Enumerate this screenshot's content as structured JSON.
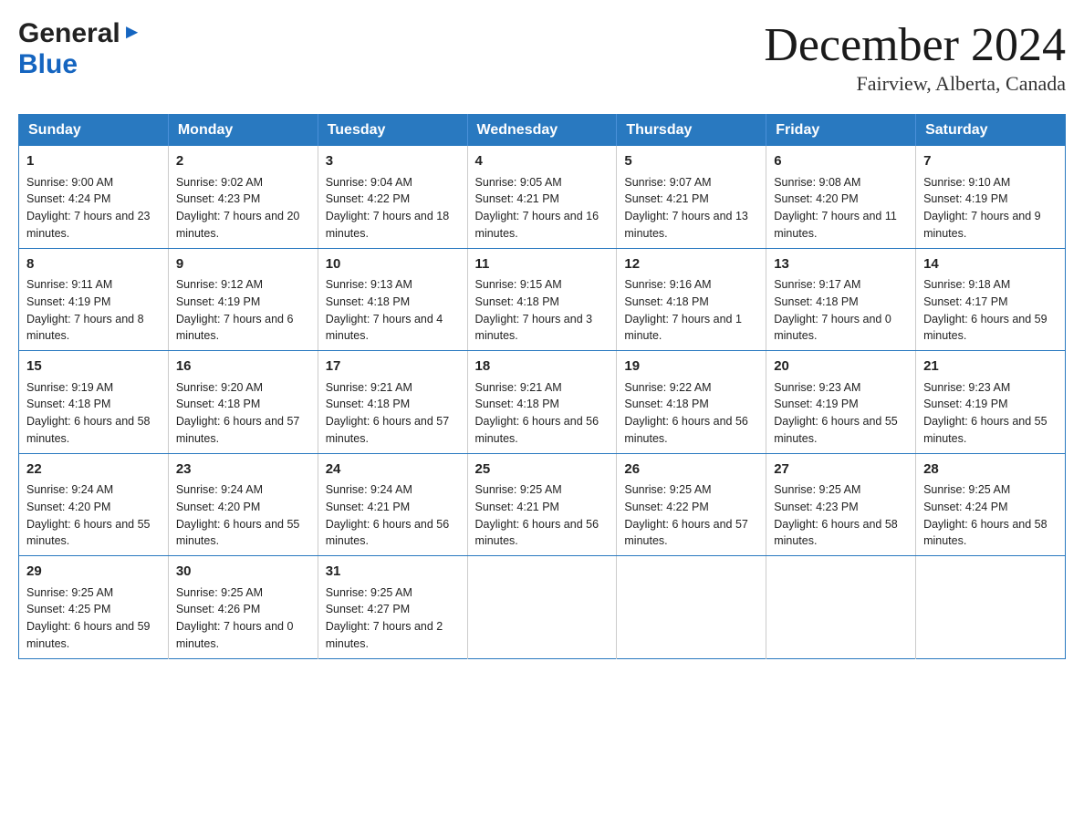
{
  "header": {
    "logo_general": "General",
    "logo_blue": "Blue",
    "month_title": "December 2024",
    "location": "Fairview, Alberta, Canada"
  },
  "calendar": {
    "days_of_week": [
      "Sunday",
      "Monday",
      "Tuesday",
      "Wednesday",
      "Thursday",
      "Friday",
      "Saturday"
    ],
    "weeks": [
      [
        {
          "day": "1",
          "sunrise": "9:00 AM",
          "sunset": "4:24 PM",
          "daylight": "7 hours and 23 minutes."
        },
        {
          "day": "2",
          "sunrise": "9:02 AM",
          "sunset": "4:23 PM",
          "daylight": "7 hours and 20 minutes."
        },
        {
          "day": "3",
          "sunrise": "9:04 AM",
          "sunset": "4:22 PM",
          "daylight": "7 hours and 18 minutes."
        },
        {
          "day": "4",
          "sunrise": "9:05 AM",
          "sunset": "4:21 PM",
          "daylight": "7 hours and 16 minutes."
        },
        {
          "day": "5",
          "sunrise": "9:07 AM",
          "sunset": "4:21 PM",
          "daylight": "7 hours and 13 minutes."
        },
        {
          "day": "6",
          "sunrise": "9:08 AM",
          "sunset": "4:20 PM",
          "daylight": "7 hours and 11 minutes."
        },
        {
          "day": "7",
          "sunrise": "9:10 AM",
          "sunset": "4:19 PM",
          "daylight": "7 hours and 9 minutes."
        }
      ],
      [
        {
          "day": "8",
          "sunrise": "9:11 AM",
          "sunset": "4:19 PM",
          "daylight": "7 hours and 8 minutes."
        },
        {
          "day": "9",
          "sunrise": "9:12 AM",
          "sunset": "4:19 PM",
          "daylight": "7 hours and 6 minutes."
        },
        {
          "day": "10",
          "sunrise": "9:13 AM",
          "sunset": "4:18 PM",
          "daylight": "7 hours and 4 minutes."
        },
        {
          "day": "11",
          "sunrise": "9:15 AM",
          "sunset": "4:18 PM",
          "daylight": "7 hours and 3 minutes."
        },
        {
          "day": "12",
          "sunrise": "9:16 AM",
          "sunset": "4:18 PM",
          "daylight": "7 hours and 1 minute."
        },
        {
          "day": "13",
          "sunrise": "9:17 AM",
          "sunset": "4:18 PM",
          "daylight": "7 hours and 0 minutes."
        },
        {
          "day": "14",
          "sunrise": "9:18 AM",
          "sunset": "4:17 PM",
          "daylight": "6 hours and 59 minutes."
        }
      ],
      [
        {
          "day": "15",
          "sunrise": "9:19 AM",
          "sunset": "4:18 PM",
          "daylight": "6 hours and 58 minutes."
        },
        {
          "day": "16",
          "sunrise": "9:20 AM",
          "sunset": "4:18 PM",
          "daylight": "6 hours and 57 minutes."
        },
        {
          "day": "17",
          "sunrise": "9:21 AM",
          "sunset": "4:18 PM",
          "daylight": "6 hours and 57 minutes."
        },
        {
          "day": "18",
          "sunrise": "9:21 AM",
          "sunset": "4:18 PM",
          "daylight": "6 hours and 56 minutes."
        },
        {
          "day": "19",
          "sunrise": "9:22 AM",
          "sunset": "4:18 PM",
          "daylight": "6 hours and 56 minutes."
        },
        {
          "day": "20",
          "sunrise": "9:23 AM",
          "sunset": "4:19 PM",
          "daylight": "6 hours and 55 minutes."
        },
        {
          "day": "21",
          "sunrise": "9:23 AM",
          "sunset": "4:19 PM",
          "daylight": "6 hours and 55 minutes."
        }
      ],
      [
        {
          "day": "22",
          "sunrise": "9:24 AM",
          "sunset": "4:20 PM",
          "daylight": "6 hours and 55 minutes."
        },
        {
          "day": "23",
          "sunrise": "9:24 AM",
          "sunset": "4:20 PM",
          "daylight": "6 hours and 55 minutes."
        },
        {
          "day": "24",
          "sunrise": "9:24 AM",
          "sunset": "4:21 PM",
          "daylight": "6 hours and 56 minutes."
        },
        {
          "day": "25",
          "sunrise": "9:25 AM",
          "sunset": "4:21 PM",
          "daylight": "6 hours and 56 minutes."
        },
        {
          "day": "26",
          "sunrise": "9:25 AM",
          "sunset": "4:22 PM",
          "daylight": "6 hours and 57 minutes."
        },
        {
          "day": "27",
          "sunrise": "9:25 AM",
          "sunset": "4:23 PM",
          "daylight": "6 hours and 58 minutes."
        },
        {
          "day": "28",
          "sunrise": "9:25 AM",
          "sunset": "4:24 PM",
          "daylight": "6 hours and 58 minutes."
        }
      ],
      [
        {
          "day": "29",
          "sunrise": "9:25 AM",
          "sunset": "4:25 PM",
          "daylight": "6 hours and 59 minutes."
        },
        {
          "day": "30",
          "sunrise": "9:25 AM",
          "sunset": "4:26 PM",
          "daylight": "7 hours and 0 minutes."
        },
        {
          "day": "31",
          "sunrise": "9:25 AM",
          "sunset": "4:27 PM",
          "daylight": "7 hours and 2 minutes."
        },
        null,
        null,
        null,
        null
      ]
    ]
  }
}
